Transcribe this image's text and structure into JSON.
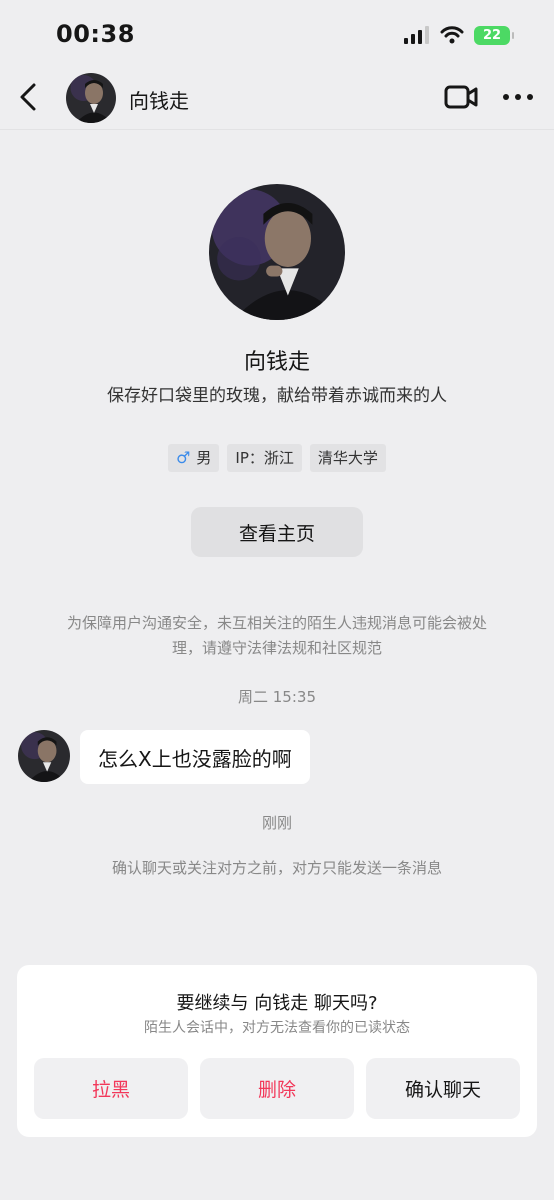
{
  "status_bar": {
    "time": "00:38",
    "battery": "22"
  },
  "header": {
    "name": "向钱走"
  },
  "profile": {
    "name": "向钱走",
    "bio": "保存好口袋里的玫瑰，献给带着赤诚而来的人",
    "tags": {
      "gender": "男",
      "ip": "IP：浙江",
      "school": "清华大学"
    },
    "view_homepage": "查看主页"
  },
  "notice": "为保障用户沟通安全，未互相关注的陌生人违规消息可能会被处理，请遵守法律法规和社区规范",
  "timestamp": "周二 15:35",
  "messages": [
    {
      "text": "怎么X上也没露脸的啊"
    }
  ],
  "just_now": "刚刚",
  "limit_notice": "确认聊天或关注对方之前，对方只能发送一条消息",
  "prompt": {
    "title": "要继续与 向钱走 聊天吗?",
    "subtitle": "陌生人会话中，对方无法查看你的已读状态",
    "block": "拉黑",
    "delete": "删除",
    "confirm": "确认聊天"
  },
  "colors": {
    "danger": "#F2385A",
    "male": "#3B8BEA",
    "battery": "#4CD964"
  }
}
